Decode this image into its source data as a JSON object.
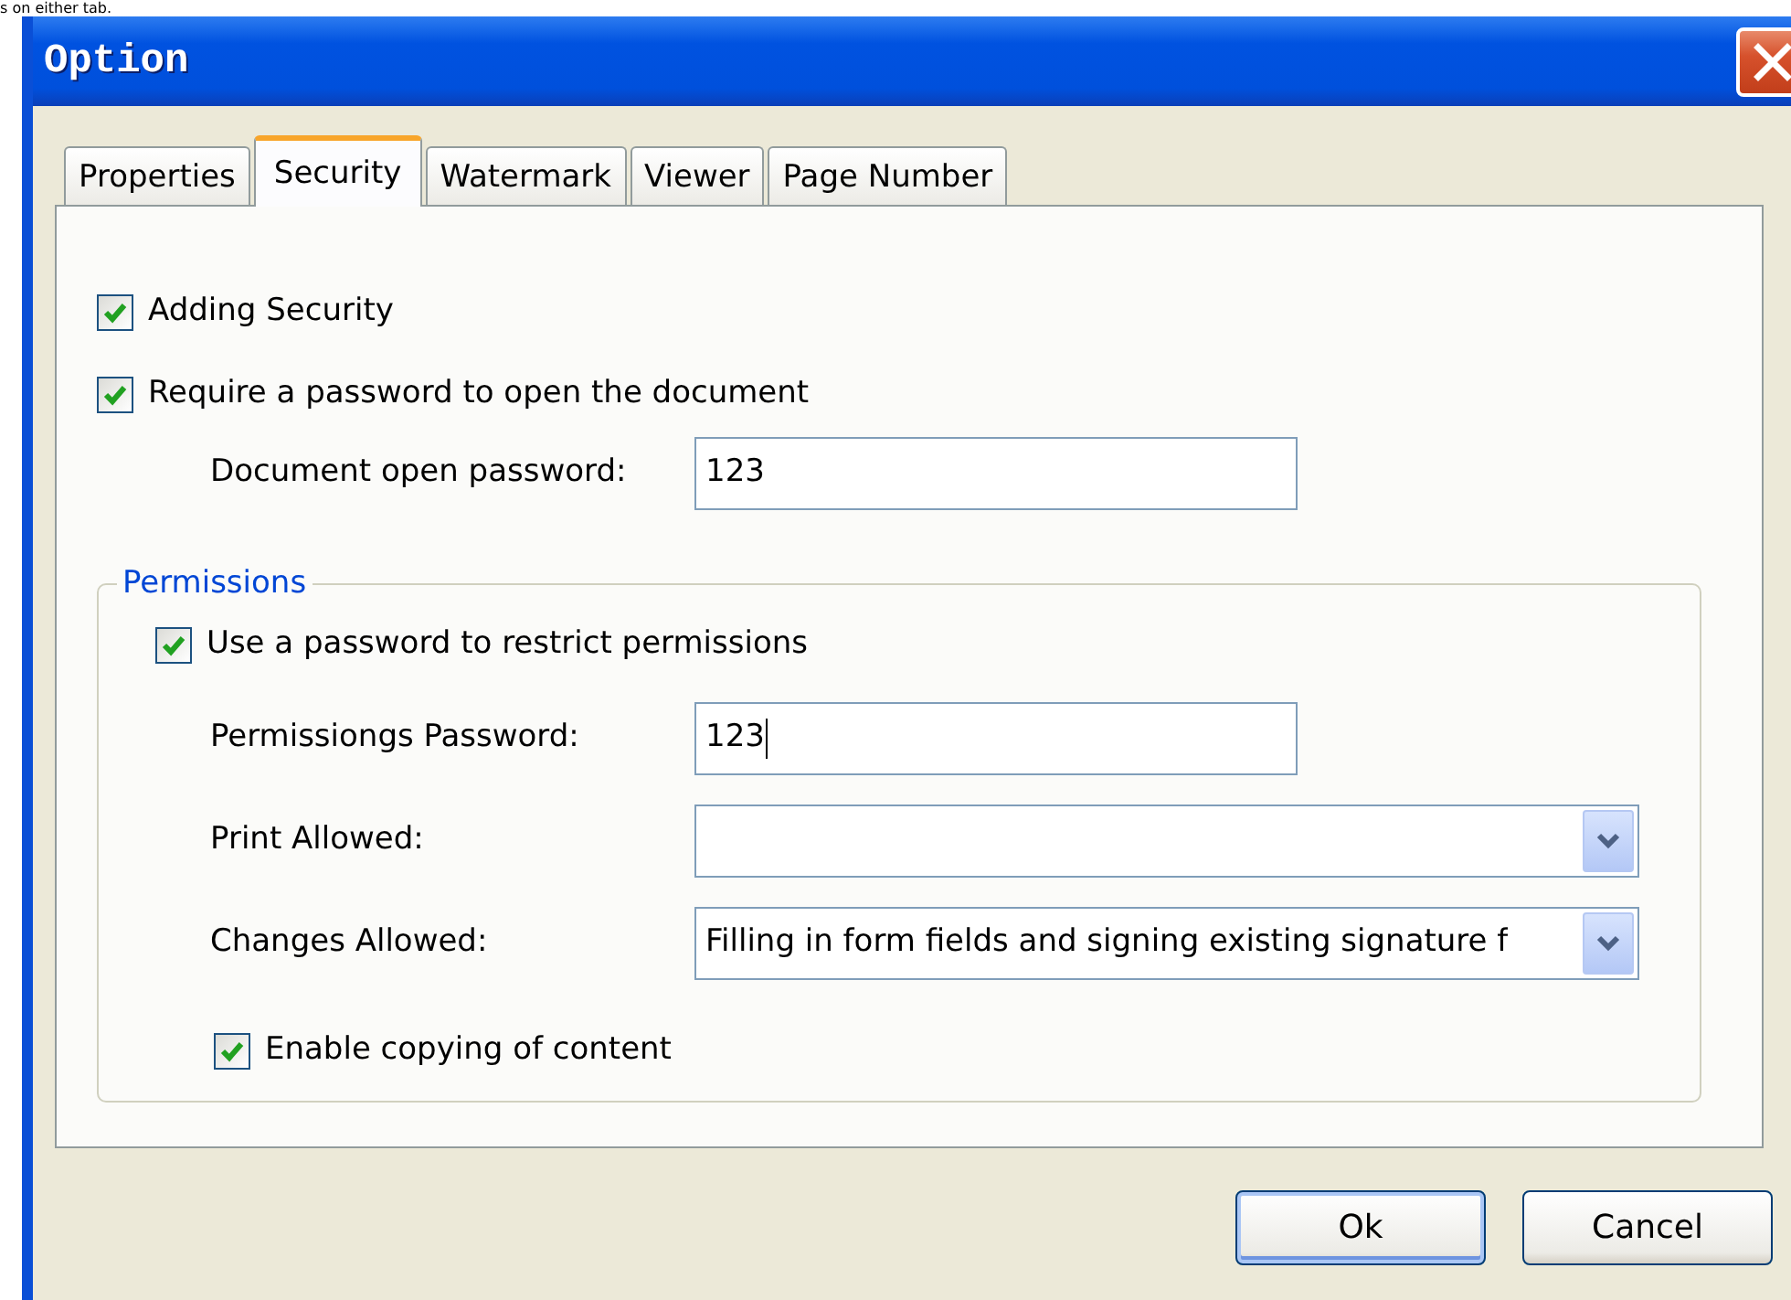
{
  "caption_fragment": "s on either tab.",
  "window": {
    "title": "Option"
  },
  "tabs": [
    {
      "label": "Properties",
      "selected": false
    },
    {
      "label": "Security",
      "selected": true
    },
    {
      "label": "Watermark",
      "selected": false
    },
    {
      "label": "Viewer",
      "selected": false
    },
    {
      "label": "Page Number",
      "selected": false
    }
  ],
  "security_options": [
    {
      "kind": "checkbox",
      "label": "Adding Security",
      "checked": true
    },
    {
      "kind": "checkbox",
      "label": "Require a password to open the document",
      "checked": true,
      "children": [
        {
          "kind": "field",
          "label": "Document open password:",
          "value": "123",
          "focused": false
        }
      ]
    }
  ],
  "permissions": {
    "legend": "Permissions",
    "items": [
      {
        "kind": "checkbox",
        "label": "Use a password to restrict permissions",
        "checked": true,
        "children": [
          {
            "kind": "field",
            "label": "Permissiongs Password:",
            "value": "123",
            "focused": true
          },
          {
            "kind": "select",
            "label": "Print Allowed:"
          },
          {
            "kind": "select",
            "label": "Changes Allowed:",
            "value": "Filling in form fields and signing existing signature f"
          },
          {
            "kind": "checkbox",
            "label": "Enable copying of content",
            "checked": true
          }
        ]
      }
    ]
  },
  "buttons": [
    {
      "label": "Ok",
      "default": true
    },
    {
      "label": "Cancel",
      "default": false
    }
  ]
}
